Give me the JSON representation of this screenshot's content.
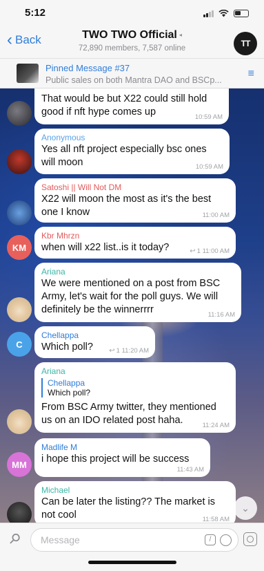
{
  "status_bar": {
    "time": "5:12"
  },
  "header": {
    "back_label": "Back",
    "title": "TWO TWO Official",
    "subtitle": "72,890 members, 7,587 online",
    "avatar_initials": "TT"
  },
  "pinned": {
    "title": "Pinned Message #37",
    "text": "Public sales on both Mantra DAO and BSCp..."
  },
  "messages": [
    {
      "sender": "",
      "text": "That would be but X22 could still hold good if nft hype comes up",
      "time": "10:59 AM"
    },
    {
      "sender": "Anonymous",
      "sender_color": "#5aa2e6",
      "text": "Yes all nft project especially bsc ones will moon",
      "time": "10:59 AM"
    },
    {
      "sender": "Satoshi || Will Not DM",
      "sender_color": "#e35a5a",
      "text": "X22 will moon the most as it's the best one I know",
      "time": "11:00 AM"
    },
    {
      "sender": "Kbr Mhrzn",
      "sender_color": "#e35a5a",
      "avatar": "KM",
      "avatar_color": "#e8605c",
      "text": "when will x22 list..is it today?",
      "time": "1 11:00 AM"
    },
    {
      "sender": "Ariana",
      "sender_color": "#3bb5a6",
      "text": "We were mentioned on a post from BSC Army, let's wait for the poll guys. We will definitely be the winnerrrr",
      "time": "11:16 AM"
    },
    {
      "sender": "Chellappa",
      "sender_color": "#2f7dd8",
      "avatar": "C",
      "avatar_color": "#4aa3e8",
      "text": "Which poll?",
      "time": "1 11:20 AM"
    },
    {
      "sender": "Ariana",
      "sender_color": "#3bb5a6",
      "reply_name": "Chellappa",
      "reply_text": "Which poll?",
      "text": "From BSC Army twitter, they mentioned us on an IDO related post haha.",
      "time": "11:24 AM"
    },
    {
      "sender": "Madlife M",
      "sender_color": "#2f7dd8",
      "avatar": "MM",
      "avatar_color": "#d873d8",
      "text": "i hope this project will be success",
      "time": "11:43 AM"
    },
    {
      "sender": "Michael",
      "sender_color": "#3bb5a6",
      "text": "Can be later the listing?? The market is not cool",
      "time": "11:58 AM"
    }
  ],
  "composer": {
    "placeholder": "Message"
  },
  "icons": [
    "back-chevron-icon",
    "signal-icon",
    "wifi-icon",
    "battery-icon",
    "mute-icon",
    "pinned-list-icon",
    "forward-icon",
    "scroll-down-icon",
    "attach-icon",
    "command-icon",
    "sticker-icon",
    "camera-icon"
  ]
}
